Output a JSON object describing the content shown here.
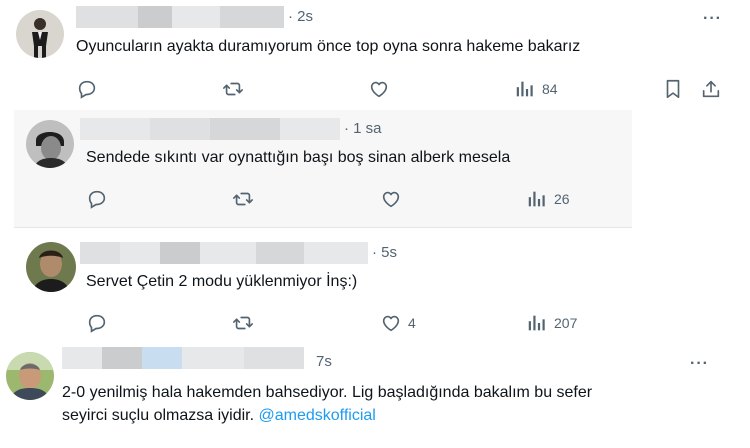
{
  "tweets": [
    {
      "time": "· 2s",
      "text": "Oyuncuların ayakta duramıyorum önce top oyna sonra hakeme bakarız",
      "views": "84"
    },
    {
      "time": "· 1 sa",
      "text": "Sendede sıkıntı var oynattığın başı boş sinan alberk mesela",
      "views": "26"
    },
    {
      "time": "· 5s",
      "text": "Servet Çetin 2 modu yüklenmiyor İnş:)",
      "likes": "4",
      "views": "207"
    },
    {
      "time": "7s",
      "text_line1": "2-0 yenilmiş hala hakemden bahsediyor. Lig başladığında bakalım bu sefer",
      "text_line2": "seyirci suçlu olmazsa iyidir.",
      "mention": "@amedskofficial"
    }
  ],
  "more_label": "···",
  "colors": {
    "mention": "#1d9bf0",
    "muted": "#536471",
    "text": "#0f1419"
  }
}
